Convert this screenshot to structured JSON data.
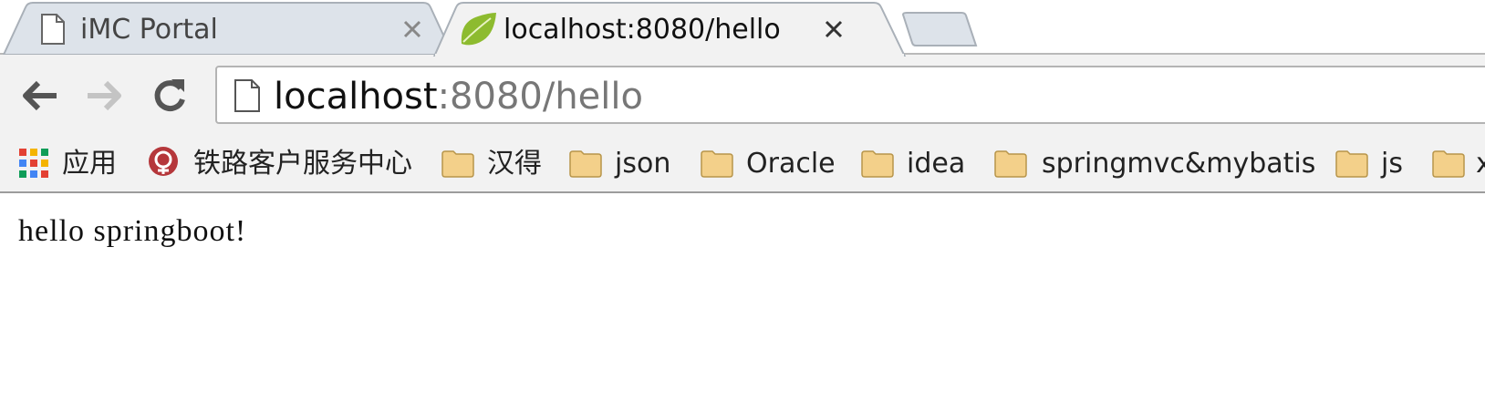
{
  "tabs": [
    {
      "title": "iMC Portal",
      "icon": "document-icon",
      "active": false
    },
    {
      "title": "localhost:8080/hello",
      "icon": "spring-leaf-icon",
      "active": true
    }
  ],
  "toolbar": {
    "url_host": "localhost",
    "url_rest": ":8080/hello"
  },
  "bookmarks": [
    {
      "label": "应用",
      "icon": "apps-grid-icon"
    },
    {
      "label": "铁路客户服务中心",
      "icon": "railway-logo-icon"
    },
    {
      "label": "汉得",
      "icon": "folder-icon"
    },
    {
      "label": "json",
      "icon": "folder-icon"
    },
    {
      "label": "Oracle",
      "icon": "folder-icon"
    },
    {
      "label": "idea",
      "icon": "folder-icon"
    },
    {
      "label": "springmvc&mybatis",
      "icon": "folder-icon"
    },
    {
      "label": "js",
      "icon": "folder-icon"
    },
    {
      "label": "x",
      "icon": "folder-icon"
    }
  ],
  "page": {
    "body_text": "hello springboot!"
  },
  "colors": {
    "active_tab": "#ffffff",
    "inactive_tab": "#dde3ea",
    "toolbar_bg": "#f2f2f2",
    "folder": "#f3d08a",
    "spring_green": "#8dbb2f"
  }
}
